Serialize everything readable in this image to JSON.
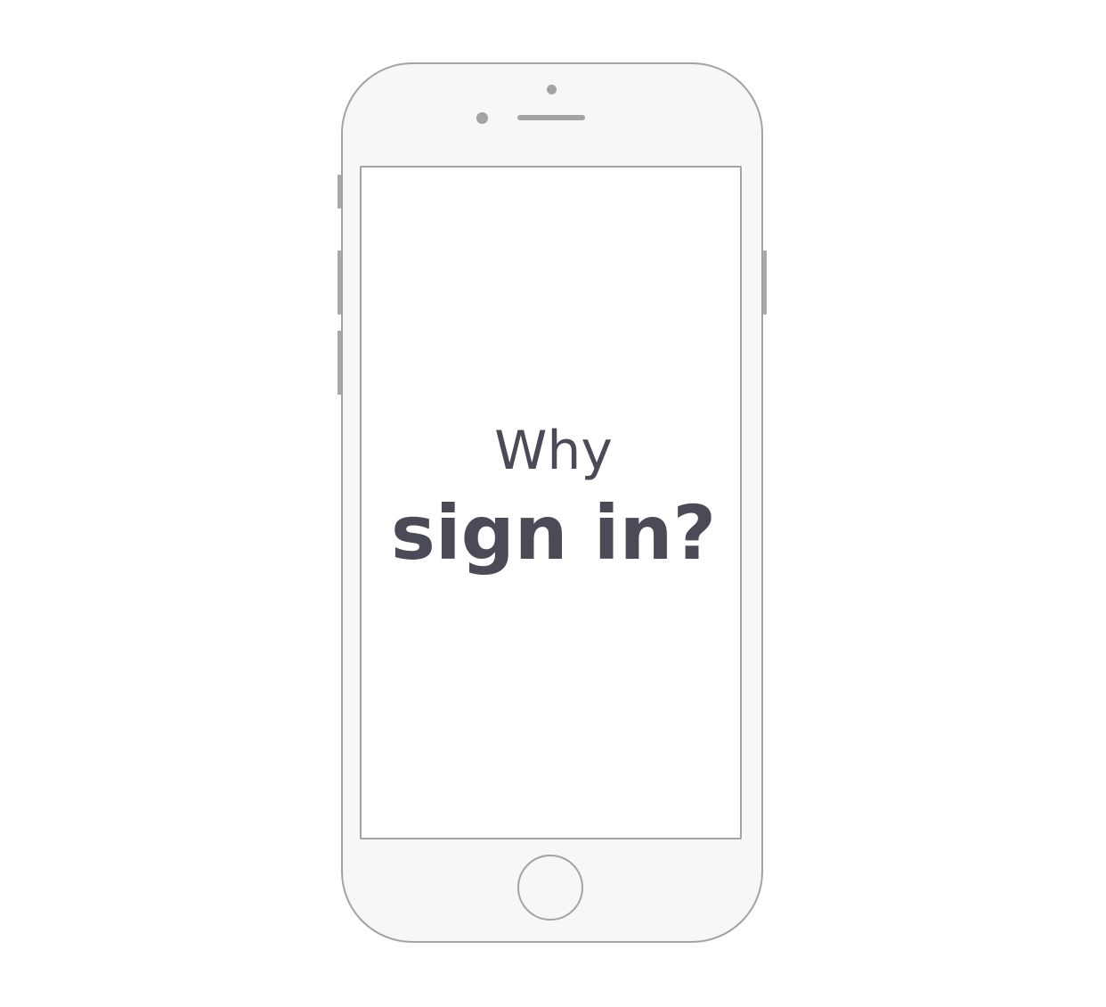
{
  "screen": {
    "line1": "Why",
    "line2": "sign in?"
  },
  "colors": {
    "text": "#4a4b56",
    "phone_outline": "#a3a3a3",
    "phone_body": "#f7f7f7",
    "screen_bg": "#ffffff"
  },
  "icons": {
    "camera": "front-camera-icon",
    "speaker": "speaker-grille-icon",
    "home": "home-button-icon"
  }
}
